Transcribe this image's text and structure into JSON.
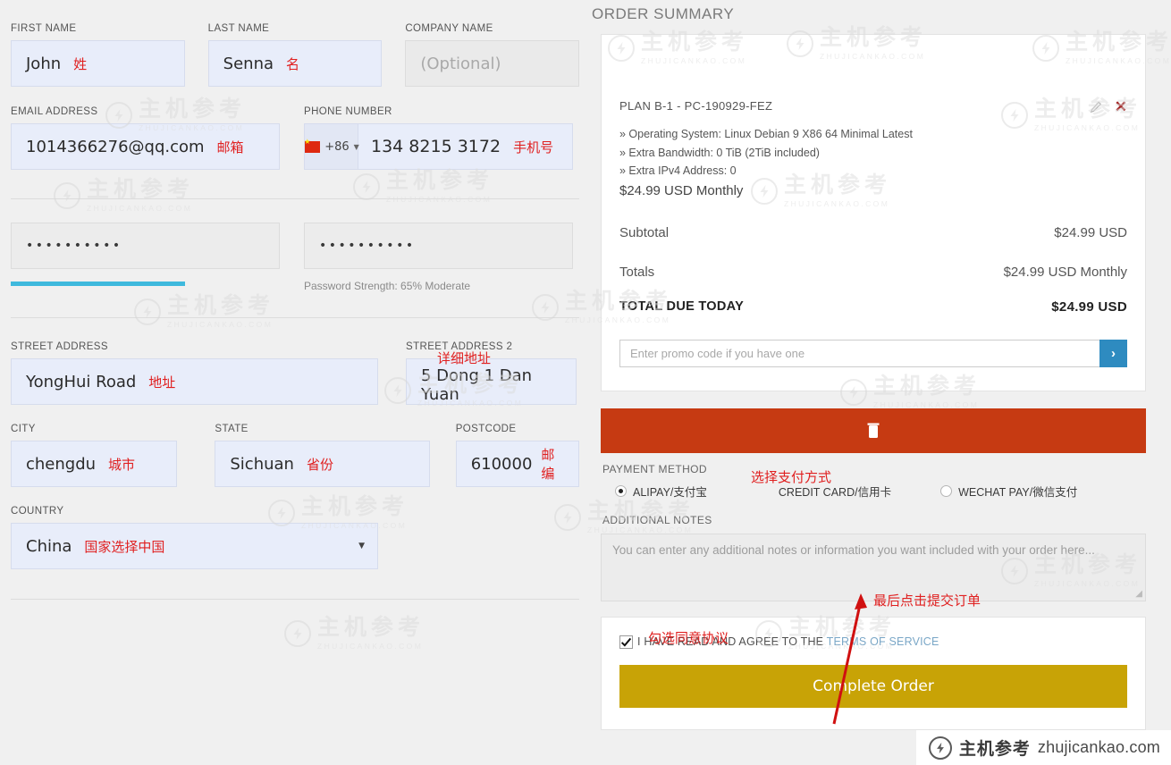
{
  "form": {
    "first_name": {
      "label": "FIRST NAME",
      "value": "John",
      "note": "姓"
    },
    "last_name": {
      "label": "LAST NAME",
      "value": "Senna",
      "note": "名"
    },
    "company_name": {
      "label": "COMPANY NAME",
      "placeholder": "(Optional)"
    },
    "email": {
      "label": "EMAIL ADDRESS",
      "value": "1014366276@qq.com",
      "note": "邮箱"
    },
    "phone": {
      "label": "PHONE NUMBER",
      "country_code": "+86",
      "value": "134 8215 3172",
      "note": "手机号"
    },
    "password": {
      "value": "••••••••••"
    },
    "confirm_password": {
      "value": "••••••••••",
      "strength": "Password Strength: 65% Moderate",
      "strength_pct": 65
    },
    "street_address": {
      "label": "STREET ADDRESS",
      "value": "YongHui Road",
      "note": "地址"
    },
    "street_address_2": {
      "label": "STREET ADDRESS 2",
      "value": "5 Dong 1 Dan Yuan",
      "note": "详细地址"
    },
    "city": {
      "label": "CITY",
      "value": "chengdu",
      "note": "城市"
    },
    "state": {
      "label": "STATE",
      "value": "Sichuan",
      "note": "省份"
    },
    "postcode": {
      "label": "POSTCODE",
      "value": "610000",
      "note": "邮编"
    },
    "country": {
      "label": "COUNTRY",
      "value": "China",
      "note": "国家选择中国"
    }
  },
  "order": {
    "title": "ORDER SUMMARY",
    "plan_name": "PLAN B-1 - PC-190929-FEZ",
    "specs": [
      "» Operating System: Linux Debian 9 X86 64 Minimal Latest",
      "» Extra Bandwidth: 0 TiB (2TiB included)",
      "» Extra IPv4 Address: 0"
    ],
    "plan_price": "$24.99 USD Monthly",
    "subtotal_label": "Subtotal",
    "subtotal_value": "$24.99 USD",
    "totals_label": "Totals",
    "totals_value": "$24.99 USD Monthly",
    "total_due_label": "TOTAL DUE TODAY",
    "total_due_value": "$24.99 USD",
    "promo_placeholder": "Enter promo code if you have one",
    "promo_submit": "›"
  },
  "payment": {
    "label": "PAYMENT METHOD",
    "note": "选择支付方式",
    "options": [
      {
        "label": "ALIPAY/支付宝",
        "selected": true
      },
      {
        "label": "CREDIT CARD/信用卡",
        "selected": false
      },
      {
        "label": "WECHAT PAY/微信支付",
        "selected": false
      }
    ]
  },
  "notes": {
    "label": "ADDITIONAL NOTES",
    "placeholder": "You can enter any additional notes or information you want included with your order here..."
  },
  "agreement": {
    "note": "勾选同意协议",
    "checked": true,
    "text_before": "I HAVE READ AND AGREE TO THE ",
    "link_text": "TERMS OF SERVICE"
  },
  "cta": {
    "label": "Complete Order",
    "note": "最后点击提交订单"
  },
  "watermark": {
    "cn": "主机参考",
    "en": "ZHUJICANKAO.COM"
  },
  "badge": {
    "cn": "主机参考",
    "en": "zhujicankao.com"
  },
  "colors": {
    "filled_field": "#e8edfa",
    "empty_field": "#eaeaea",
    "accent_blue": "#2e8bc0",
    "delete_red": "#c63a12",
    "cta_gold": "#c8a306",
    "annotation_red": "#e02020",
    "strength_cyan": "#3fb9dd"
  }
}
